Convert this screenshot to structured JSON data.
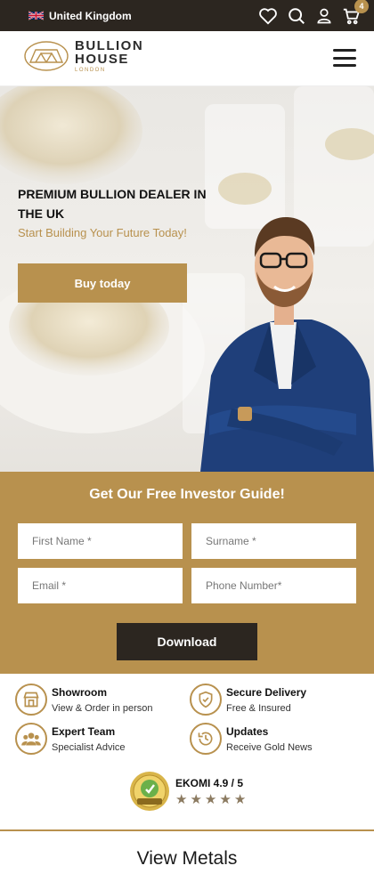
{
  "topbar": {
    "region": "United Kingdom",
    "cart_count": "4",
    "icons": [
      "uk-flag-icon",
      "heart-icon",
      "search-icon",
      "user-icon",
      "cart-icon"
    ]
  },
  "header": {
    "logo_line1": "BULLION",
    "logo_line2": "HOUSE",
    "logo_line3": "LONDON"
  },
  "hero": {
    "title": "PREMIUM BULLION DEALER IN THE UK",
    "subtitle": "Start Building Your Future Today!",
    "cta": "Buy today"
  },
  "guide": {
    "title": "Get Our Free Investor Guide!",
    "fields": {
      "first_name": "First Name *",
      "surname": "Surname *",
      "email": "Email *",
      "phone": "Phone Number*"
    },
    "submit": "Download"
  },
  "features": [
    {
      "title": "Showroom",
      "subtitle": "View & Order in person",
      "icon": "store-icon"
    },
    {
      "title": "Secure Delivery",
      "subtitle": "Free & Insured",
      "icon": "shield-icon"
    },
    {
      "title": "Expert Team",
      "subtitle": "Specialist Advice",
      "icon": "team-icon"
    },
    {
      "title": "Updates",
      "subtitle": "Receive Gold News",
      "icon": "clock-icon"
    }
  ],
  "ekomi": {
    "rating": "EKOMI  4.9 / 5",
    "stars": 5,
    "seal_text": "EKOMI"
  },
  "sections": {
    "view_metals": "View Metals"
  },
  "colors": {
    "brand_gold": "#b8914e",
    "dark": "#2c2620"
  }
}
